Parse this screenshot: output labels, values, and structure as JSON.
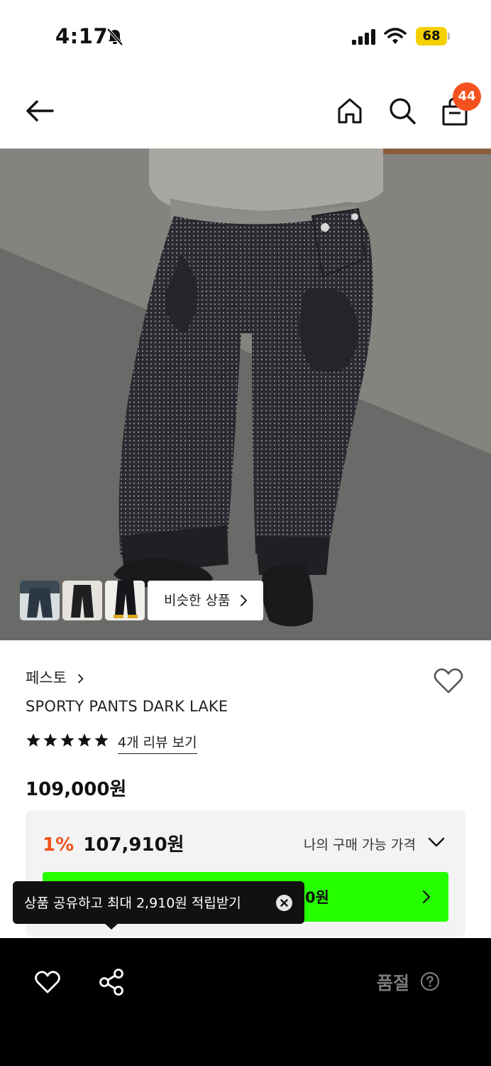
{
  "status_bar": {
    "time": "4:17",
    "battery": "68"
  },
  "header": {
    "cart_count": "44"
  },
  "product_image": {
    "thumbnails": [
      "thumbnail-1",
      "thumbnail-2",
      "thumbnail-3"
    ],
    "similar_label": "비슷한 상품"
  },
  "product": {
    "brand": "페스토",
    "title": "SPORTY PANTS DARK LAKE",
    "rating": 5,
    "review_link": "4개 리뷰 보기",
    "price": "109,000원"
  },
  "price_box": {
    "discount_rate": "1%",
    "discounted_price": "107,910원",
    "my_price_label": "나의 구매 가능 가격",
    "coupon_text_visible": "0원"
  },
  "tooltip": {
    "text": "상품 공유하고 최대 2,910원 적립받기"
  },
  "bottom_bar": {
    "status": "품절"
  },
  "colors": {
    "accent_orange": "#f4511e",
    "coupon_green": "#26ff00",
    "bottom_bar": "#000000"
  }
}
